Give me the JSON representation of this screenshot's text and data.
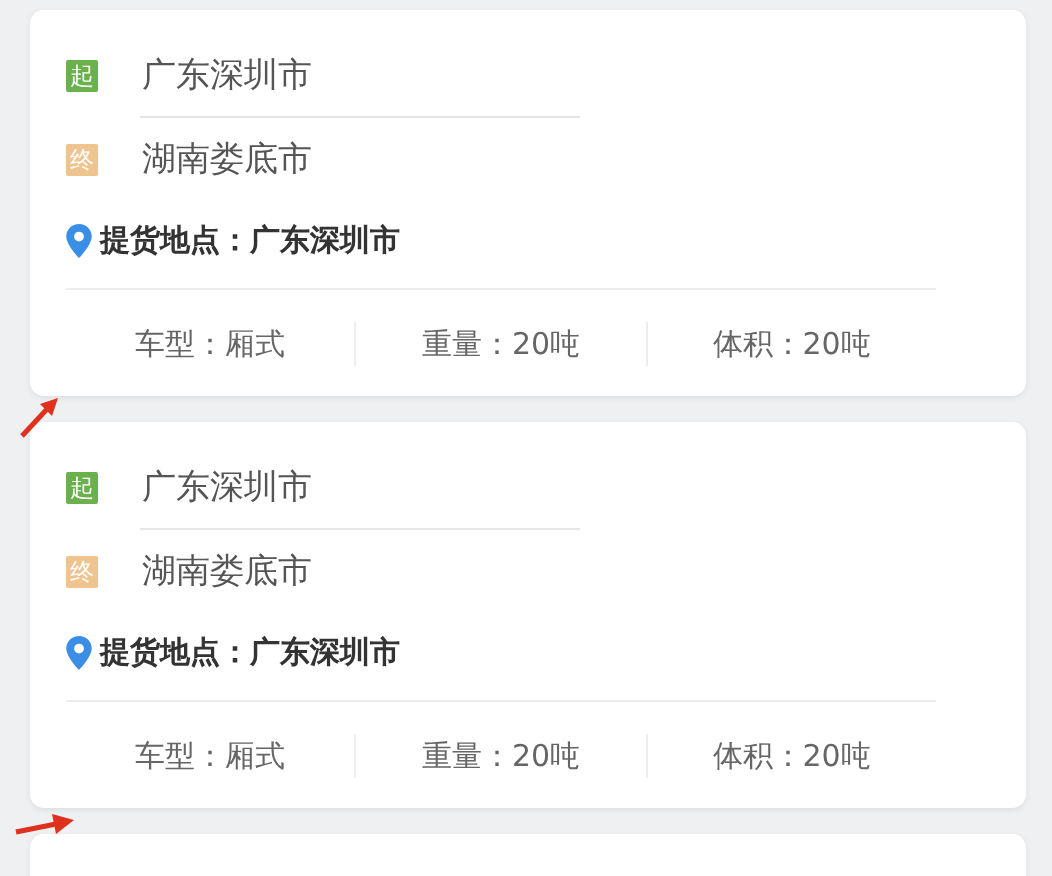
{
  "orders": [
    {
      "stops": [
        {
          "badge": "起",
          "city": "广东深圳市",
          "color": "#6ab04c"
        },
        {
          "badge": "终",
          "city": "湖南娄底市",
          "color": "#f0c48e"
        }
      ],
      "pickup": "提货地点：广东深圳市",
      "specs": [
        "车型：厢式",
        "重量：20吨",
        "体积：20吨"
      ]
    },
    {
      "stops": [
        {
          "badge": "起",
          "city": "广东深圳市",
          "color": "#6ab04c"
        },
        {
          "badge": "终",
          "city": "湖南娄底市",
          "color": "#f0c48e"
        }
      ],
      "pickup": "提货地点：广东深圳市",
      "specs": [
        "车型：厢式",
        "重量：20吨",
        "体积：20吨"
      ]
    }
  ]
}
